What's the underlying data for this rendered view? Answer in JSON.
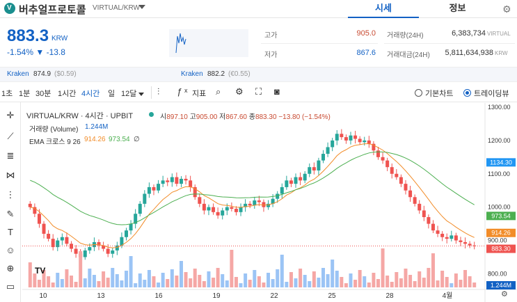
{
  "header": {
    "coin_name": "버추얼프로토콜",
    "pair": "VIRTUAL/KRW",
    "tabs": [
      {
        "label": "시세"
      },
      {
        "label": "정보"
      }
    ]
  },
  "price": {
    "current": "883.3",
    "unit": "KRW",
    "change": "-1.54% ▼ -13.8"
  },
  "stats": {
    "high_label": "고가",
    "high_value": "905.0",
    "low_label": "저가",
    "low_value": "867.6",
    "vol_label": "거래량(24H)",
    "vol_value": "6,383,734",
    "vol_unit": "VIRTUAL",
    "amt_label": "거래대금(24H)",
    "amt_value": "5,811,634,938",
    "amt_unit": "KRW"
  },
  "exchanges": [
    {
      "name": "Kraken",
      "price": "874.9",
      "diff": "($0.59)"
    },
    {
      "name": "Kraken",
      "price": "882.2",
      "diff": "(€0.55)"
    }
  ],
  "toolbar": {
    "intervals": [
      "1초",
      "1분",
      "30분",
      "1시간",
      "4시간",
      "일",
      "12달"
    ],
    "active_interval": "4시간",
    "indicator_label": "지표",
    "basic_chart": "기본차트",
    "trading_view": "트레이딩뷰"
  },
  "legend": {
    "title": "VIRTUAL/KRW · 4시간 · UPBIT",
    "o_lbl": "시",
    "o": "897.10",
    "h_lbl": "고",
    "h": "905.00",
    "l_lbl": "저",
    "l": "867.60",
    "c_lbl": "종",
    "c": "883.30",
    "chg": "−13.80 (−1.54%)",
    "vol_label": "거래량 (Volume)",
    "vol_value": "1.244M",
    "ema_label": "EMA 크로스 9 26",
    "ema_fast": "914.26",
    "ema_slow": "973.54",
    "ema_end": "∅"
  },
  "colors": {
    "up": "#26a69a",
    "down": "#ef5350",
    "ema_fast": "#f28c28",
    "ema_slow": "#4caf50",
    "accent": "#1261c4"
  },
  "chart_data": {
    "type": "candlestick",
    "y_ticks": [
      "1300.00",
      "1200.00",
      "1100.00",
      "1000.00",
      "900.00",
      "800.00"
    ],
    "ylim": [
      780,
      1300
    ],
    "x_ticks": [
      "10",
      "13",
      "16",
      "19",
      "22",
      "25",
      "28",
      "4월"
    ],
    "price_tags": [
      {
        "value": "1134.30",
        "color": "#2196f3"
      },
      {
        "value": "973.54",
        "color": "#4caf50"
      },
      {
        "value": "914.26",
        "color": "#f28c28"
      },
      {
        "value": "883.30",
        "color": "#ef5350"
      },
      {
        "value": "1.244M",
        "color": "#1261c4"
      }
    ],
    "close": [
      1000,
      980,
      950,
      920,
      905,
      880,
      900,
      910,
      890,
      875,
      860,
      850,
      870,
      880,
      895,
      885,
      875,
      860,
      870,
      885,
      910,
      930,
      950,
      980,
      1010,
      1040,
      1060,
      1050,
      1070,
      1080,
      1075,
      1090,
      1070,
      1085,
      1080,
      1060,
      1030,
      1010,
      990,
      1000,
      985,
      975,
      990,
      1000,
      995,
      985,
      1000,
      1010,
      1005,
      1020,
      1015,
      1000,
      1010,
      1025,
      1040,
      1060,
      1080,
      1070,
      1090,
      1080,
      1100,
      1120,
      1110,
      1140,
      1160,
      1180,
      1200,
      1220,
      1210,
      1200,
      1215,
      1205,
      1195,
      1200,
      1190,
      1170,
      1150,
      1140,
      1120,
      1100,
      1090,
      1070,
      1050,
      1030,
      1010,
      990,
      970,
      950,
      930,
      920,
      910,
      905,
      915,
      900,
      895,
      890,
      885,
      883.3
    ]
  }
}
